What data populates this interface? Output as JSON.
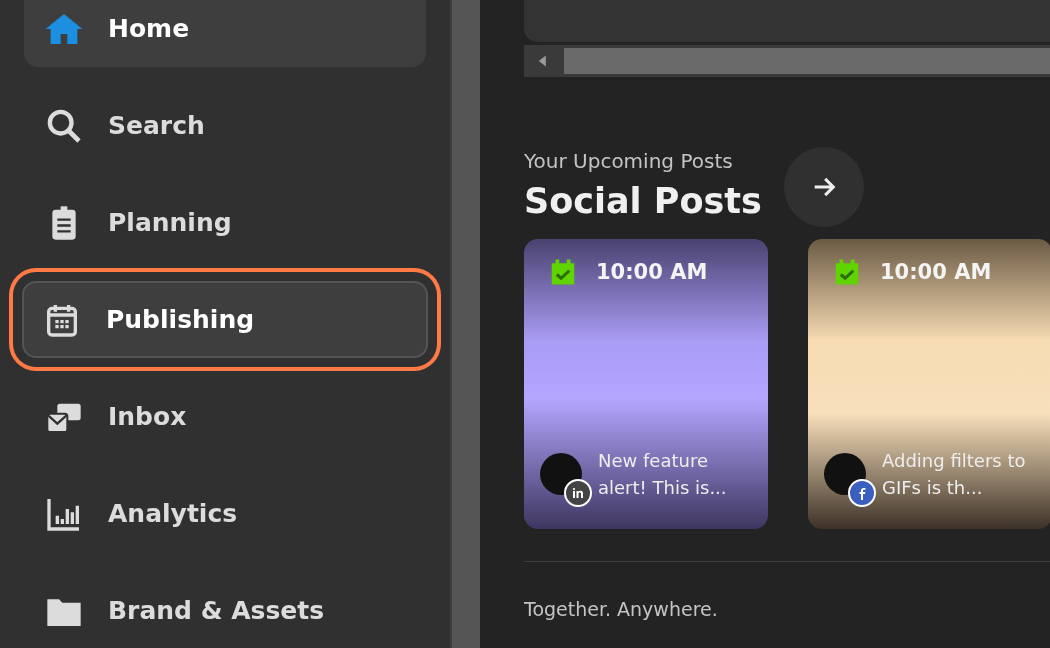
{
  "sidebar": {
    "items": [
      {
        "label": "Home",
        "active": true,
        "selected": false
      },
      {
        "label": "Search",
        "active": false,
        "selected": false
      },
      {
        "label": "Planning",
        "active": false,
        "selected": false
      },
      {
        "label": "Publishing",
        "active": false,
        "selected": true
      },
      {
        "label": "Inbox",
        "active": false,
        "selected": false
      },
      {
        "label": "Analytics",
        "active": false,
        "selected": false
      },
      {
        "label": "Brand & Assets",
        "active": false,
        "selected": false
      }
    ]
  },
  "upcoming": {
    "eyebrow": "Your Upcoming Posts",
    "title": "Social Posts",
    "posts": [
      {
        "time": "10:00 AM",
        "text": "New feature alert! This is...",
        "kind": "linkedin"
      },
      {
        "time": "10:00 AM",
        "text": "Adding filters to GIFs is th...",
        "kind": "facebook"
      }
    ]
  },
  "footer": {
    "text": "Together. Anywhere."
  }
}
